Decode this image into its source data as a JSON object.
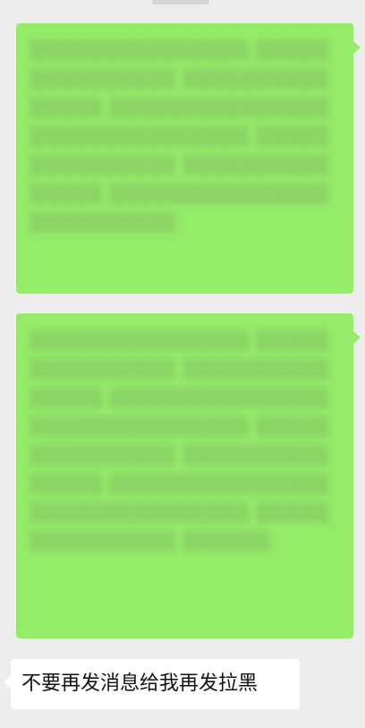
{
  "messages": {
    "received": {
      "text": "不要再发消息给我再发拉黑"
    }
  },
  "colors": {
    "background": "#ededed",
    "sent_bubble": "#95ec69",
    "received_bubble": "#ffffff"
  }
}
